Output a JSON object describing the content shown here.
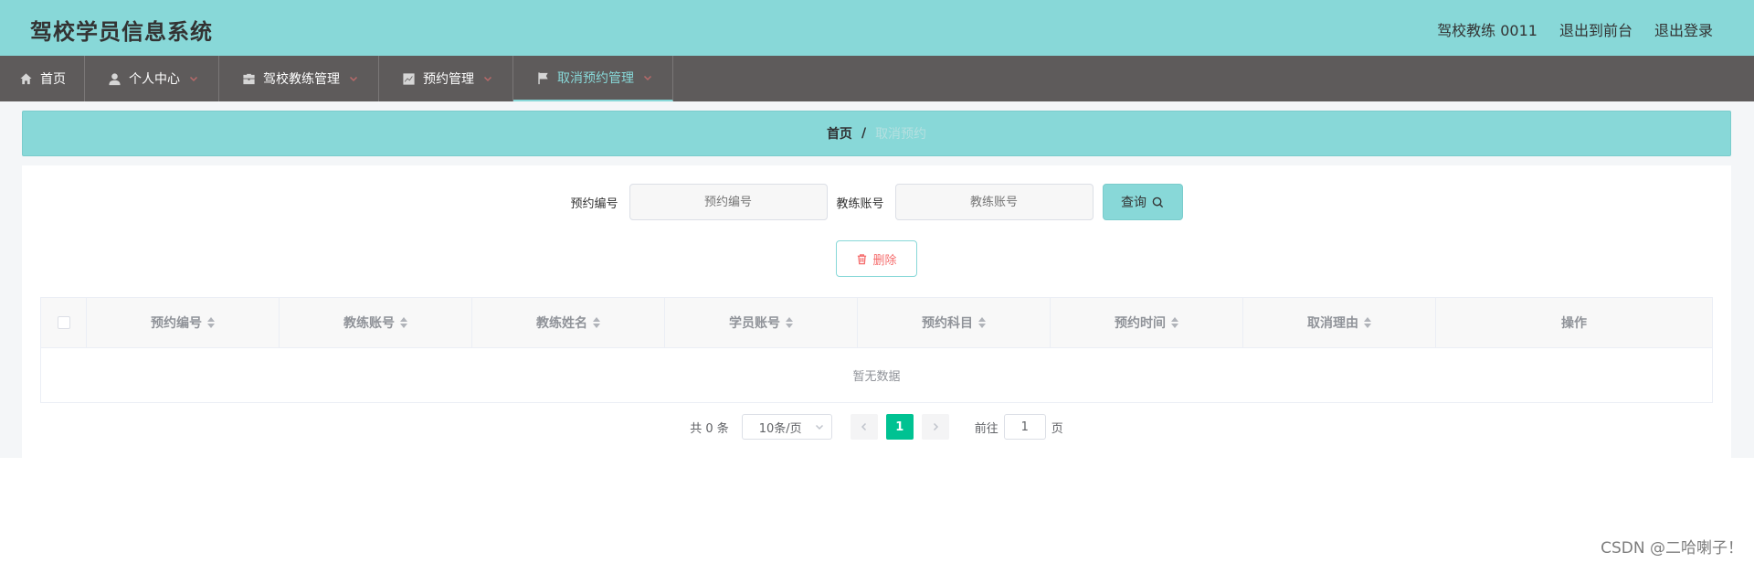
{
  "header": {
    "title": "驾校学员信息系统",
    "user": "驾校教练 0011",
    "exit_front": "退出到前台",
    "logout": "退出登录"
  },
  "nav": [
    {
      "label": "首页",
      "icon": "home-icon"
    },
    {
      "label": "个人中心",
      "icon": "user-icon"
    },
    {
      "label": "驾校教练管理",
      "icon": "briefcase-icon"
    },
    {
      "label": "预约管理",
      "icon": "chart-icon"
    },
    {
      "label": "取消预约管理",
      "icon": "flag-icon",
      "active": true
    }
  ],
  "breadcrumb": {
    "home": "首页",
    "separator": "/",
    "current": "取消预约"
  },
  "search": {
    "field1_label": "预约编号",
    "field1_placeholder": "预约编号",
    "field2_label": "教练账号",
    "field2_placeholder": "教练账号",
    "query_label": "查询"
  },
  "actions": {
    "delete_label": "删除"
  },
  "table": {
    "columns": [
      "预约编号",
      "教练账号",
      "教练姓名",
      "学员账号",
      "预约科目",
      "预约时间",
      "取消理由",
      "操作"
    ],
    "empty_text": "暂无数据"
  },
  "pagination": {
    "total_text": "共 0 条",
    "page_size": "10条/页",
    "current_page": "1",
    "goto_label": "前往",
    "goto_value": "1",
    "page_suffix": "页"
  },
  "colors": {
    "accent": "#88d8d8",
    "nav_bg": "#5e5b5b",
    "pager_active": "#00c292",
    "danger": "#f56c6c"
  },
  "watermark": "CSDN @二哈喇子！"
}
